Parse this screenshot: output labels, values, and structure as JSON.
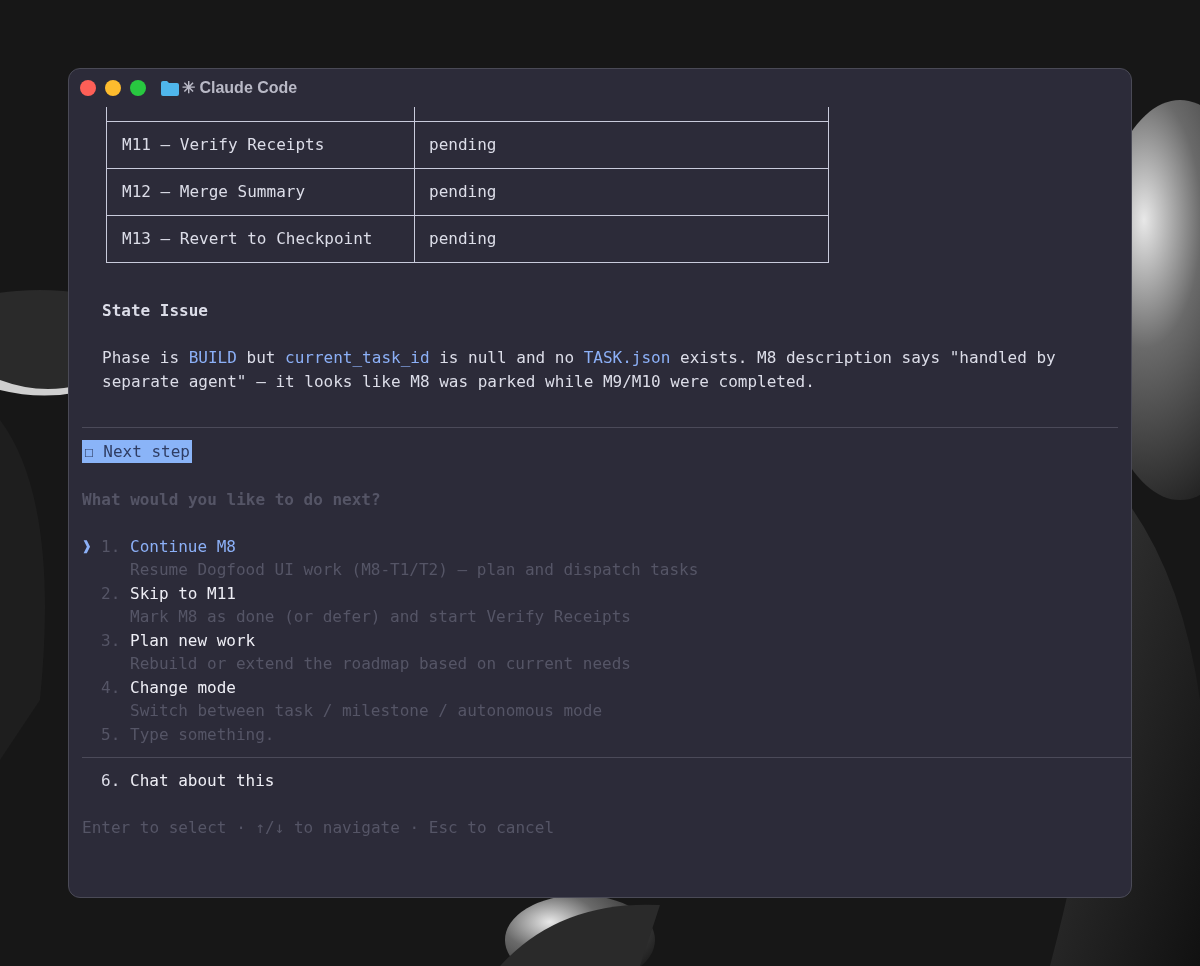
{
  "window": {
    "title": "✳ Claude Code"
  },
  "table": {
    "rows": [
      {
        "cells": [
          "M11 — Verify Receipts",
          "pending"
        ]
      },
      {
        "cells": [
          "M12 — Merge Summary",
          "pending"
        ]
      },
      {
        "cells": [
          "M13 — Revert to Checkpoint",
          "pending"
        ]
      }
    ]
  },
  "heading": "State Issue",
  "paragraph": [
    {
      "kind": "plain",
      "text": "Phase is "
    },
    {
      "kind": "code",
      "text": "BUILD"
    },
    {
      "kind": "plain",
      "text": " but "
    },
    {
      "kind": "code",
      "text": "current_task_id"
    },
    {
      "kind": "plain",
      "text": " is null and no "
    },
    {
      "kind": "code",
      "text": "TASK.json"
    },
    {
      "kind": "plain",
      "text": " exists. M8 description says \"handled by separate agent\" — it looks like M8 was parked while M9/M10 were completed."
    }
  ],
  "badge": "☐ Next step",
  "question": "What would you like to do next?",
  "cursor": "❱",
  "options": [
    {
      "kind": "option",
      "number": "1.",
      "label": "Continue M8",
      "description": "Resume Dogfood UI work (M8-T1/T2) — plan and dispatch tasks",
      "selected": true
    },
    {
      "kind": "option",
      "number": "2.",
      "label": "Skip to M11",
      "description": "Mark M8 as done (or defer) and start Verify Receipts",
      "selected": false
    },
    {
      "kind": "option",
      "number": "3.",
      "label": "Plan new work",
      "description": "Rebuild or extend the roadmap based on current needs",
      "selected": false
    },
    {
      "kind": "option",
      "number": "4.",
      "label": "Change mode",
      "description": "Switch between task / milestone / autonomous mode",
      "selected": false
    },
    {
      "kind": "input",
      "number": "5.",
      "label": "Type something.",
      "selected": false
    },
    {
      "kind": "extra",
      "number": "6.",
      "label": "Chat about this",
      "selected": false
    }
  ],
  "footer": "Enter to select · ↑/↓ to navigate · Esc to cancel"
}
